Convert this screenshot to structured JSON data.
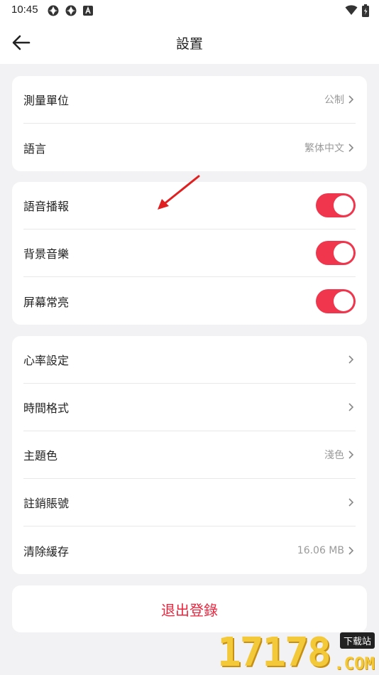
{
  "status_bar": {
    "time": "10:45"
  },
  "header": {
    "title": "設置"
  },
  "card1": {
    "items": [
      {
        "label": "測量單位",
        "value": "公制"
      },
      {
        "label": "語言",
        "value": "繁体中文"
      }
    ]
  },
  "card2": {
    "items": [
      {
        "label": "語音播報",
        "on": true
      },
      {
        "label": "背景音樂",
        "on": true
      },
      {
        "label": "屏幕常亮",
        "on": true
      }
    ]
  },
  "card3": {
    "items": [
      {
        "label": "心率設定",
        "value": ""
      },
      {
        "label": "時間格式",
        "value": ""
      },
      {
        "label": "主題色",
        "value": "淺色"
      },
      {
        "label": "註銷賬號",
        "value": ""
      },
      {
        "label": "清除緩存",
        "value": "16.06 MB"
      }
    ]
  },
  "logout": {
    "label": "退出登錄"
  },
  "watermark": {
    "numbers": "17178",
    "badge": "下载站",
    "domain": ".COM"
  },
  "colors": {
    "accent": "#f0364c",
    "logout_text": "#e8263e"
  }
}
